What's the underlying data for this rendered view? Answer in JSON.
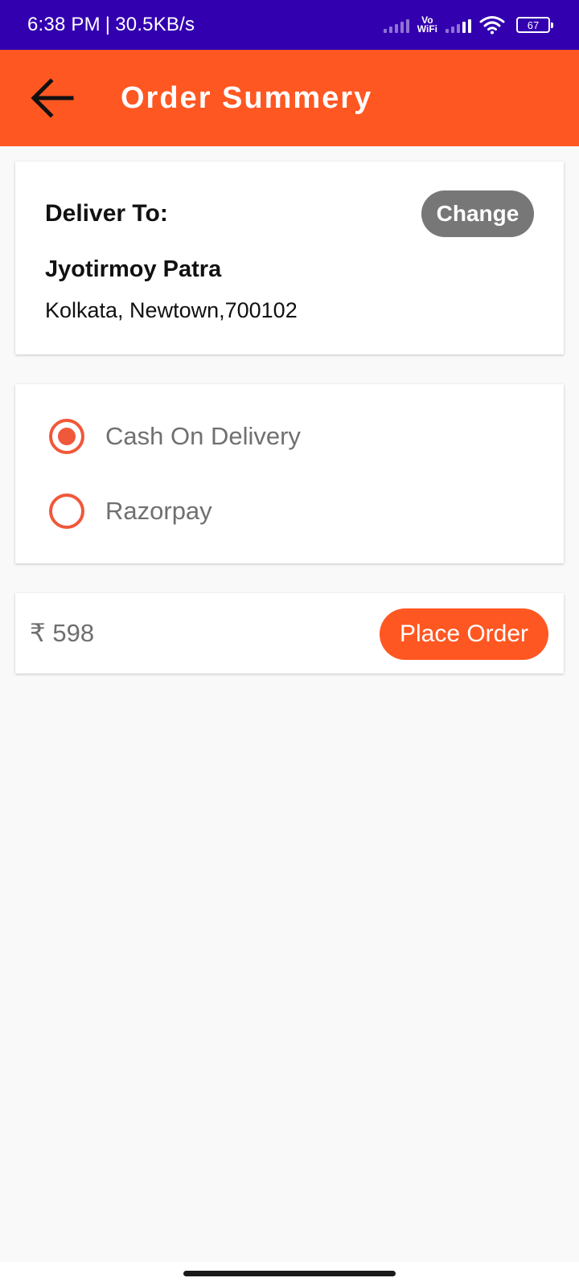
{
  "status_bar": {
    "time": "6:38 PM",
    "separator": "|",
    "net_speed": "30.5KB/s",
    "vowifi_top": "Vo",
    "vowifi_bottom": "WiFi",
    "battery": "67"
  },
  "app_bar": {
    "title": "Order Summery",
    "back_icon": "arrow-left-icon"
  },
  "address": {
    "label": "Deliver To:",
    "change_label": "Change",
    "name": "Jyotirmoy Patra",
    "line": "Kolkata, Newtown,700102"
  },
  "payment": {
    "options": [
      {
        "label": "Cash On Delivery",
        "selected": true
      },
      {
        "label": "Razorpay",
        "selected": false
      }
    ]
  },
  "total": {
    "amount": "₹ 598",
    "place_order_label": "Place Order"
  },
  "colors": {
    "status_bar": "#3300b0",
    "primary": "#ff5722",
    "radio": "#f0583a",
    "change_button": "#777777",
    "background": "#f9f9f9"
  }
}
